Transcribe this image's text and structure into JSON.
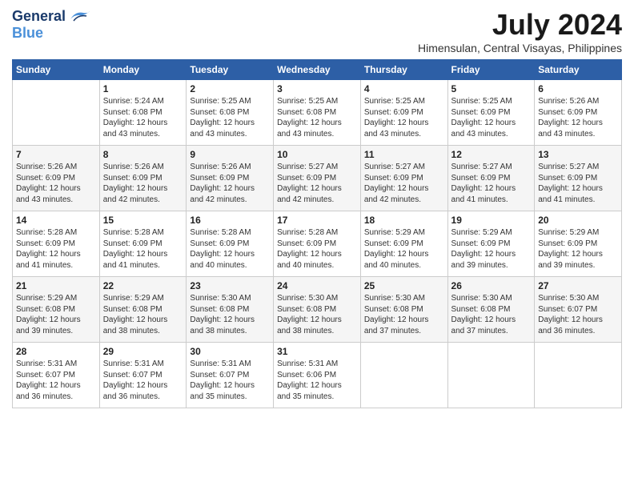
{
  "logo": {
    "line1": "General",
    "line2": "Blue"
  },
  "title": "July 2024",
  "location": "Himensulan, Central Visayas, Philippines",
  "header_days": [
    "Sunday",
    "Monday",
    "Tuesday",
    "Wednesday",
    "Thursday",
    "Friday",
    "Saturday"
  ],
  "weeks": [
    [
      null,
      {
        "day": "1",
        "sunrise": "Sunrise: 5:24 AM",
        "sunset": "Sunset: 6:08 PM",
        "daylight": "Daylight: 12 hours and 43 minutes."
      },
      {
        "day": "2",
        "sunrise": "Sunrise: 5:25 AM",
        "sunset": "Sunset: 6:08 PM",
        "daylight": "Daylight: 12 hours and 43 minutes."
      },
      {
        "day": "3",
        "sunrise": "Sunrise: 5:25 AM",
        "sunset": "Sunset: 6:08 PM",
        "daylight": "Daylight: 12 hours and 43 minutes."
      },
      {
        "day": "4",
        "sunrise": "Sunrise: 5:25 AM",
        "sunset": "Sunset: 6:09 PM",
        "daylight": "Daylight: 12 hours and 43 minutes."
      },
      {
        "day": "5",
        "sunrise": "Sunrise: 5:25 AM",
        "sunset": "Sunset: 6:09 PM",
        "daylight": "Daylight: 12 hours and 43 minutes."
      },
      {
        "day": "6",
        "sunrise": "Sunrise: 5:26 AM",
        "sunset": "Sunset: 6:09 PM",
        "daylight": "Daylight: 12 hours and 43 minutes."
      }
    ],
    [
      {
        "day": "7",
        "sunrise": "Sunrise: 5:26 AM",
        "sunset": "Sunset: 6:09 PM",
        "daylight": "Daylight: 12 hours and 43 minutes."
      },
      {
        "day": "8",
        "sunrise": "Sunrise: 5:26 AM",
        "sunset": "Sunset: 6:09 PM",
        "daylight": "Daylight: 12 hours and 42 minutes."
      },
      {
        "day": "9",
        "sunrise": "Sunrise: 5:26 AM",
        "sunset": "Sunset: 6:09 PM",
        "daylight": "Daylight: 12 hours and 42 minutes."
      },
      {
        "day": "10",
        "sunrise": "Sunrise: 5:27 AM",
        "sunset": "Sunset: 6:09 PM",
        "daylight": "Daylight: 12 hours and 42 minutes."
      },
      {
        "day": "11",
        "sunrise": "Sunrise: 5:27 AM",
        "sunset": "Sunset: 6:09 PM",
        "daylight": "Daylight: 12 hours and 42 minutes."
      },
      {
        "day": "12",
        "sunrise": "Sunrise: 5:27 AM",
        "sunset": "Sunset: 6:09 PM",
        "daylight": "Daylight: 12 hours and 41 minutes."
      },
      {
        "day": "13",
        "sunrise": "Sunrise: 5:27 AM",
        "sunset": "Sunset: 6:09 PM",
        "daylight": "Daylight: 12 hours and 41 minutes."
      }
    ],
    [
      {
        "day": "14",
        "sunrise": "Sunrise: 5:28 AM",
        "sunset": "Sunset: 6:09 PM",
        "daylight": "Daylight: 12 hours and 41 minutes."
      },
      {
        "day": "15",
        "sunrise": "Sunrise: 5:28 AM",
        "sunset": "Sunset: 6:09 PM",
        "daylight": "Daylight: 12 hours and 41 minutes."
      },
      {
        "day": "16",
        "sunrise": "Sunrise: 5:28 AM",
        "sunset": "Sunset: 6:09 PM",
        "daylight": "Daylight: 12 hours and 40 minutes."
      },
      {
        "day": "17",
        "sunrise": "Sunrise: 5:28 AM",
        "sunset": "Sunset: 6:09 PM",
        "daylight": "Daylight: 12 hours and 40 minutes."
      },
      {
        "day": "18",
        "sunrise": "Sunrise: 5:29 AM",
        "sunset": "Sunset: 6:09 PM",
        "daylight": "Daylight: 12 hours and 40 minutes."
      },
      {
        "day": "19",
        "sunrise": "Sunrise: 5:29 AM",
        "sunset": "Sunset: 6:09 PM",
        "daylight": "Daylight: 12 hours and 39 minutes."
      },
      {
        "day": "20",
        "sunrise": "Sunrise: 5:29 AM",
        "sunset": "Sunset: 6:09 PM",
        "daylight": "Daylight: 12 hours and 39 minutes."
      }
    ],
    [
      {
        "day": "21",
        "sunrise": "Sunrise: 5:29 AM",
        "sunset": "Sunset: 6:08 PM",
        "daylight": "Daylight: 12 hours and 39 minutes."
      },
      {
        "day": "22",
        "sunrise": "Sunrise: 5:29 AM",
        "sunset": "Sunset: 6:08 PM",
        "daylight": "Daylight: 12 hours and 38 minutes."
      },
      {
        "day": "23",
        "sunrise": "Sunrise: 5:30 AM",
        "sunset": "Sunset: 6:08 PM",
        "daylight": "Daylight: 12 hours and 38 minutes."
      },
      {
        "day": "24",
        "sunrise": "Sunrise: 5:30 AM",
        "sunset": "Sunset: 6:08 PM",
        "daylight": "Daylight: 12 hours and 38 minutes."
      },
      {
        "day": "25",
        "sunrise": "Sunrise: 5:30 AM",
        "sunset": "Sunset: 6:08 PM",
        "daylight": "Daylight: 12 hours and 37 minutes."
      },
      {
        "day": "26",
        "sunrise": "Sunrise: 5:30 AM",
        "sunset": "Sunset: 6:08 PM",
        "daylight": "Daylight: 12 hours and 37 minutes."
      },
      {
        "day": "27",
        "sunrise": "Sunrise: 5:30 AM",
        "sunset": "Sunset: 6:07 PM",
        "daylight": "Daylight: 12 hours and 36 minutes."
      }
    ],
    [
      {
        "day": "28",
        "sunrise": "Sunrise: 5:31 AM",
        "sunset": "Sunset: 6:07 PM",
        "daylight": "Daylight: 12 hours and 36 minutes."
      },
      {
        "day": "29",
        "sunrise": "Sunrise: 5:31 AM",
        "sunset": "Sunset: 6:07 PM",
        "daylight": "Daylight: 12 hours and 36 minutes."
      },
      {
        "day": "30",
        "sunrise": "Sunrise: 5:31 AM",
        "sunset": "Sunset: 6:07 PM",
        "daylight": "Daylight: 12 hours and 35 minutes."
      },
      {
        "day": "31",
        "sunrise": "Sunrise: 5:31 AM",
        "sunset": "Sunset: 6:06 PM",
        "daylight": "Daylight: 12 hours and 35 minutes."
      },
      null,
      null,
      null
    ]
  ]
}
